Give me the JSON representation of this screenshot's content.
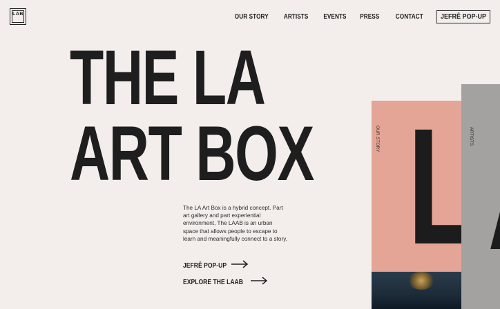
{
  "brand": {
    "logo_text": "LAB"
  },
  "nav": {
    "links": [
      "OUR STORY",
      "ARTISTS",
      "EVENTS",
      "PRESS",
      "CONTACT"
    ],
    "cta": "JEFRĒ POP-UP"
  },
  "hero": {
    "title_line1": "THE LA",
    "title_line2": "ART BOX",
    "description": "The LA Art Box is a hybrid concept. Part art gallery and part experiential environment, The LAAB is an urban space that allows people to escape to learn and meaningfully connect to a story."
  },
  "ctas": [
    {
      "label": "JEFRĒ POP-UP",
      "icon": "arrow-right-icon"
    },
    {
      "label": "EXPLORE THE LAAB",
      "icon": "arrow-right-icon"
    }
  ],
  "cards": [
    {
      "label": "OUR STORY",
      "letter": "L",
      "color": "#e4a597"
    },
    {
      "label": "ARTISTS",
      "letter": "A",
      "color": "#a3a2a0"
    }
  ]
}
